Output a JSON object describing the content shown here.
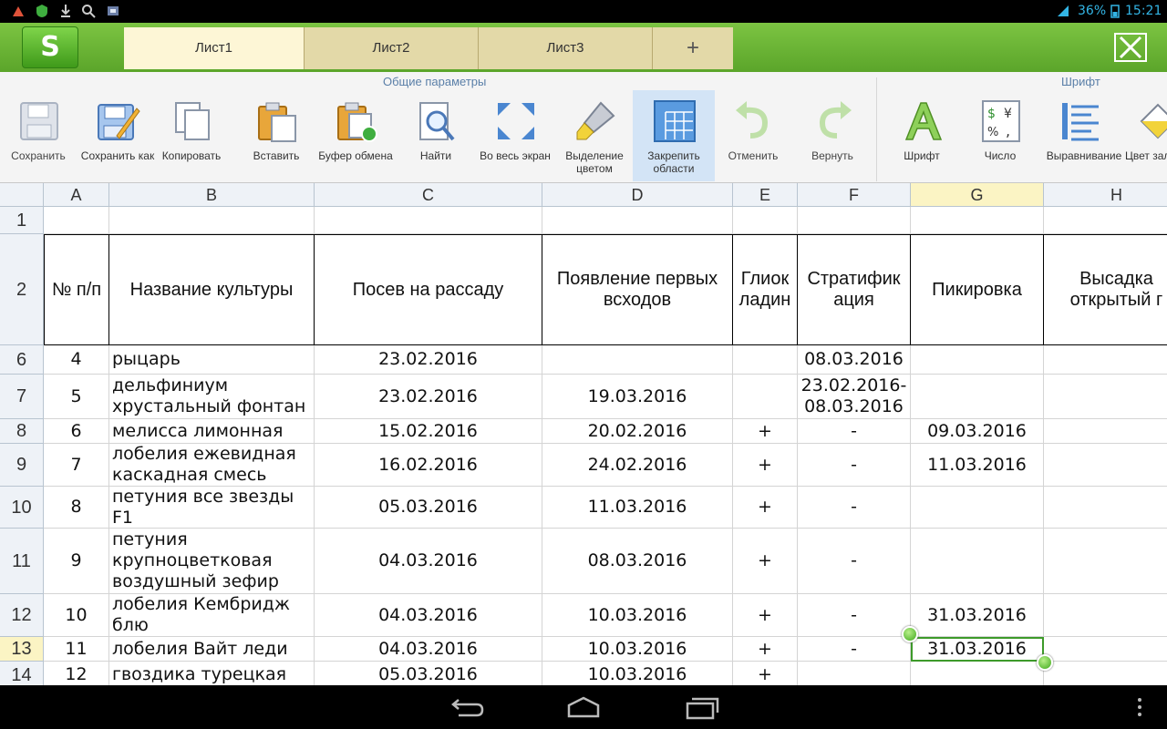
{
  "status": {
    "battery": "36%",
    "clock": "15:21"
  },
  "app": {
    "logo": "S"
  },
  "tabs": [
    {
      "label": "Лист1",
      "active": true
    },
    {
      "label": "Лист2",
      "active": false
    },
    {
      "label": "Лист3",
      "active": false
    }
  ],
  "add_tab_label": "+",
  "ribbon": {
    "group1_title": "Общие параметры",
    "group2_title": "Шрифт",
    "tools": [
      {
        "label": "Сохранить",
        "icon": "save-icon"
      },
      {
        "label": "Сохранить как",
        "icon": "save-as-icon"
      },
      {
        "label": "Копировать",
        "icon": "copy-icon"
      },
      {
        "label": "Вставить",
        "icon": "paste-icon"
      },
      {
        "label": "Буфер обмена",
        "icon": "clipboard-icon"
      },
      {
        "label": "Найти",
        "icon": "find-icon"
      },
      {
        "label": "Во весь экран",
        "icon": "fullscreen-icon"
      },
      {
        "label": "Выделение цветом",
        "icon": "highlight-icon"
      },
      {
        "label": "Закрепить области",
        "icon": "freeze-panes-icon"
      },
      {
        "label": "Отменить",
        "icon": "undo-icon"
      },
      {
        "label": "Вернуть",
        "icon": "redo-icon"
      },
      {
        "label": "Шрифт",
        "icon": "font-icon"
      },
      {
        "label": "Число",
        "icon": "number-format-icon"
      },
      {
        "label": "Выравнивание",
        "icon": "align-icon"
      },
      {
        "label": "Цвет зал",
        "icon": "fill-color-icon"
      }
    ]
  },
  "grid": {
    "columns": [
      "A",
      "B",
      "C",
      "D",
      "E",
      "F",
      "G",
      "H"
    ],
    "selected_cell": "G13",
    "header_row": [
      "№ п/п",
      "Название культуры",
      "Посев на рассаду",
      "Появление первых всходов",
      "Глиок ладин",
      "Стратифик ация",
      "Пикировка",
      "Высадка открытый г"
    ],
    "rows": [
      {
        "num": "1",
        "cells": [
          "",
          "",
          "",
          "",
          "",
          "",
          "",
          ""
        ]
      },
      {
        "num": "6",
        "cells": [
          "4",
          "рыцарь",
          "23.02.2016",
          "",
          "",
          "08.03.2016",
          "",
          ""
        ]
      },
      {
        "num": "7",
        "cells": [
          "5",
          "дельфиниум хрустальный фонтан",
          "23.02.2016",
          "19.03.2016",
          "",
          "23.02.2016-08.03.2016",
          "",
          ""
        ]
      },
      {
        "num": "8",
        "cells": [
          "6",
          "мелисса лимонная",
          "15.02.2016",
          "20.02.2016",
          "+",
          "-",
          "09.03.2016",
          ""
        ]
      },
      {
        "num": "9",
        "cells": [
          "7",
          "лобелия ежевидная каскадная смесь",
          "16.02.2016",
          "24.02.2016",
          "+",
          "-",
          "11.03.2016",
          ""
        ]
      },
      {
        "num": "10",
        "cells": [
          "8",
          "петуния все звезды F1",
          "05.03.2016",
          "11.03.2016",
          "+",
          "-",
          "",
          ""
        ]
      },
      {
        "num": "11",
        "cells": [
          "9",
          "петуния крупноцветковая воздушный зефир",
          "04.03.2016",
          "08.03.2016",
          "+",
          "-",
          "",
          ""
        ]
      },
      {
        "num": "12",
        "cells": [
          "10",
          "лобелия Кембридж блю",
          "04.03.2016",
          "10.03.2016",
          "+",
          "-",
          "31.03.2016",
          ""
        ]
      },
      {
        "num": "13",
        "cells": [
          "11",
          "лобелия Вайт леди",
          "04.03.2016",
          "10.03.2016",
          "+",
          "-",
          "31.03.2016",
          ""
        ]
      },
      {
        "num": "14",
        "cells": [
          "12",
          "гвоздика турецкая",
          "05.03.2016",
          "10.03.2016",
          "+",
          "",
          "",
          ""
        ]
      }
    ]
  }
}
